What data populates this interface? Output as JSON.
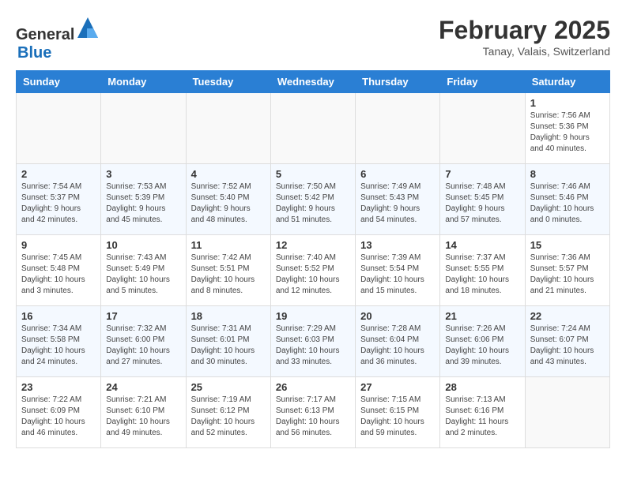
{
  "header": {
    "logo_general": "General",
    "logo_blue": "Blue",
    "month_year": "February 2025",
    "location": "Tanay, Valais, Switzerland"
  },
  "days_of_week": [
    "Sunday",
    "Monday",
    "Tuesday",
    "Wednesday",
    "Thursday",
    "Friday",
    "Saturday"
  ],
  "weeks": [
    {
      "days": [
        {
          "number": "",
          "info": ""
        },
        {
          "number": "",
          "info": ""
        },
        {
          "number": "",
          "info": ""
        },
        {
          "number": "",
          "info": ""
        },
        {
          "number": "",
          "info": ""
        },
        {
          "number": "",
          "info": ""
        },
        {
          "number": "1",
          "info": "Sunrise: 7:56 AM\nSunset: 5:36 PM\nDaylight: 9 hours and 40 minutes."
        }
      ]
    },
    {
      "days": [
        {
          "number": "2",
          "info": "Sunrise: 7:54 AM\nSunset: 5:37 PM\nDaylight: 9 hours and 42 minutes."
        },
        {
          "number": "3",
          "info": "Sunrise: 7:53 AM\nSunset: 5:39 PM\nDaylight: 9 hours and 45 minutes."
        },
        {
          "number": "4",
          "info": "Sunrise: 7:52 AM\nSunset: 5:40 PM\nDaylight: 9 hours and 48 minutes."
        },
        {
          "number": "5",
          "info": "Sunrise: 7:50 AM\nSunset: 5:42 PM\nDaylight: 9 hours and 51 minutes."
        },
        {
          "number": "6",
          "info": "Sunrise: 7:49 AM\nSunset: 5:43 PM\nDaylight: 9 hours and 54 minutes."
        },
        {
          "number": "7",
          "info": "Sunrise: 7:48 AM\nSunset: 5:45 PM\nDaylight: 9 hours and 57 minutes."
        },
        {
          "number": "8",
          "info": "Sunrise: 7:46 AM\nSunset: 5:46 PM\nDaylight: 10 hours and 0 minutes."
        }
      ]
    },
    {
      "days": [
        {
          "number": "9",
          "info": "Sunrise: 7:45 AM\nSunset: 5:48 PM\nDaylight: 10 hours and 3 minutes."
        },
        {
          "number": "10",
          "info": "Sunrise: 7:43 AM\nSunset: 5:49 PM\nDaylight: 10 hours and 5 minutes."
        },
        {
          "number": "11",
          "info": "Sunrise: 7:42 AM\nSunset: 5:51 PM\nDaylight: 10 hours and 8 minutes."
        },
        {
          "number": "12",
          "info": "Sunrise: 7:40 AM\nSunset: 5:52 PM\nDaylight: 10 hours and 12 minutes."
        },
        {
          "number": "13",
          "info": "Sunrise: 7:39 AM\nSunset: 5:54 PM\nDaylight: 10 hours and 15 minutes."
        },
        {
          "number": "14",
          "info": "Sunrise: 7:37 AM\nSunset: 5:55 PM\nDaylight: 10 hours and 18 minutes."
        },
        {
          "number": "15",
          "info": "Sunrise: 7:36 AM\nSunset: 5:57 PM\nDaylight: 10 hours and 21 minutes."
        }
      ]
    },
    {
      "days": [
        {
          "number": "16",
          "info": "Sunrise: 7:34 AM\nSunset: 5:58 PM\nDaylight: 10 hours and 24 minutes."
        },
        {
          "number": "17",
          "info": "Sunrise: 7:32 AM\nSunset: 6:00 PM\nDaylight: 10 hours and 27 minutes."
        },
        {
          "number": "18",
          "info": "Sunrise: 7:31 AM\nSunset: 6:01 PM\nDaylight: 10 hours and 30 minutes."
        },
        {
          "number": "19",
          "info": "Sunrise: 7:29 AM\nSunset: 6:03 PM\nDaylight: 10 hours and 33 minutes."
        },
        {
          "number": "20",
          "info": "Sunrise: 7:28 AM\nSunset: 6:04 PM\nDaylight: 10 hours and 36 minutes."
        },
        {
          "number": "21",
          "info": "Sunrise: 7:26 AM\nSunset: 6:06 PM\nDaylight: 10 hours and 39 minutes."
        },
        {
          "number": "22",
          "info": "Sunrise: 7:24 AM\nSunset: 6:07 PM\nDaylight: 10 hours and 43 minutes."
        }
      ]
    },
    {
      "days": [
        {
          "number": "23",
          "info": "Sunrise: 7:22 AM\nSunset: 6:09 PM\nDaylight: 10 hours and 46 minutes."
        },
        {
          "number": "24",
          "info": "Sunrise: 7:21 AM\nSunset: 6:10 PM\nDaylight: 10 hours and 49 minutes."
        },
        {
          "number": "25",
          "info": "Sunrise: 7:19 AM\nSunset: 6:12 PM\nDaylight: 10 hours and 52 minutes."
        },
        {
          "number": "26",
          "info": "Sunrise: 7:17 AM\nSunset: 6:13 PM\nDaylight: 10 hours and 56 minutes."
        },
        {
          "number": "27",
          "info": "Sunrise: 7:15 AM\nSunset: 6:15 PM\nDaylight: 10 hours and 59 minutes."
        },
        {
          "number": "28",
          "info": "Sunrise: 7:13 AM\nSunset: 6:16 PM\nDaylight: 11 hours and 2 minutes."
        },
        {
          "number": "",
          "info": ""
        }
      ]
    }
  ]
}
